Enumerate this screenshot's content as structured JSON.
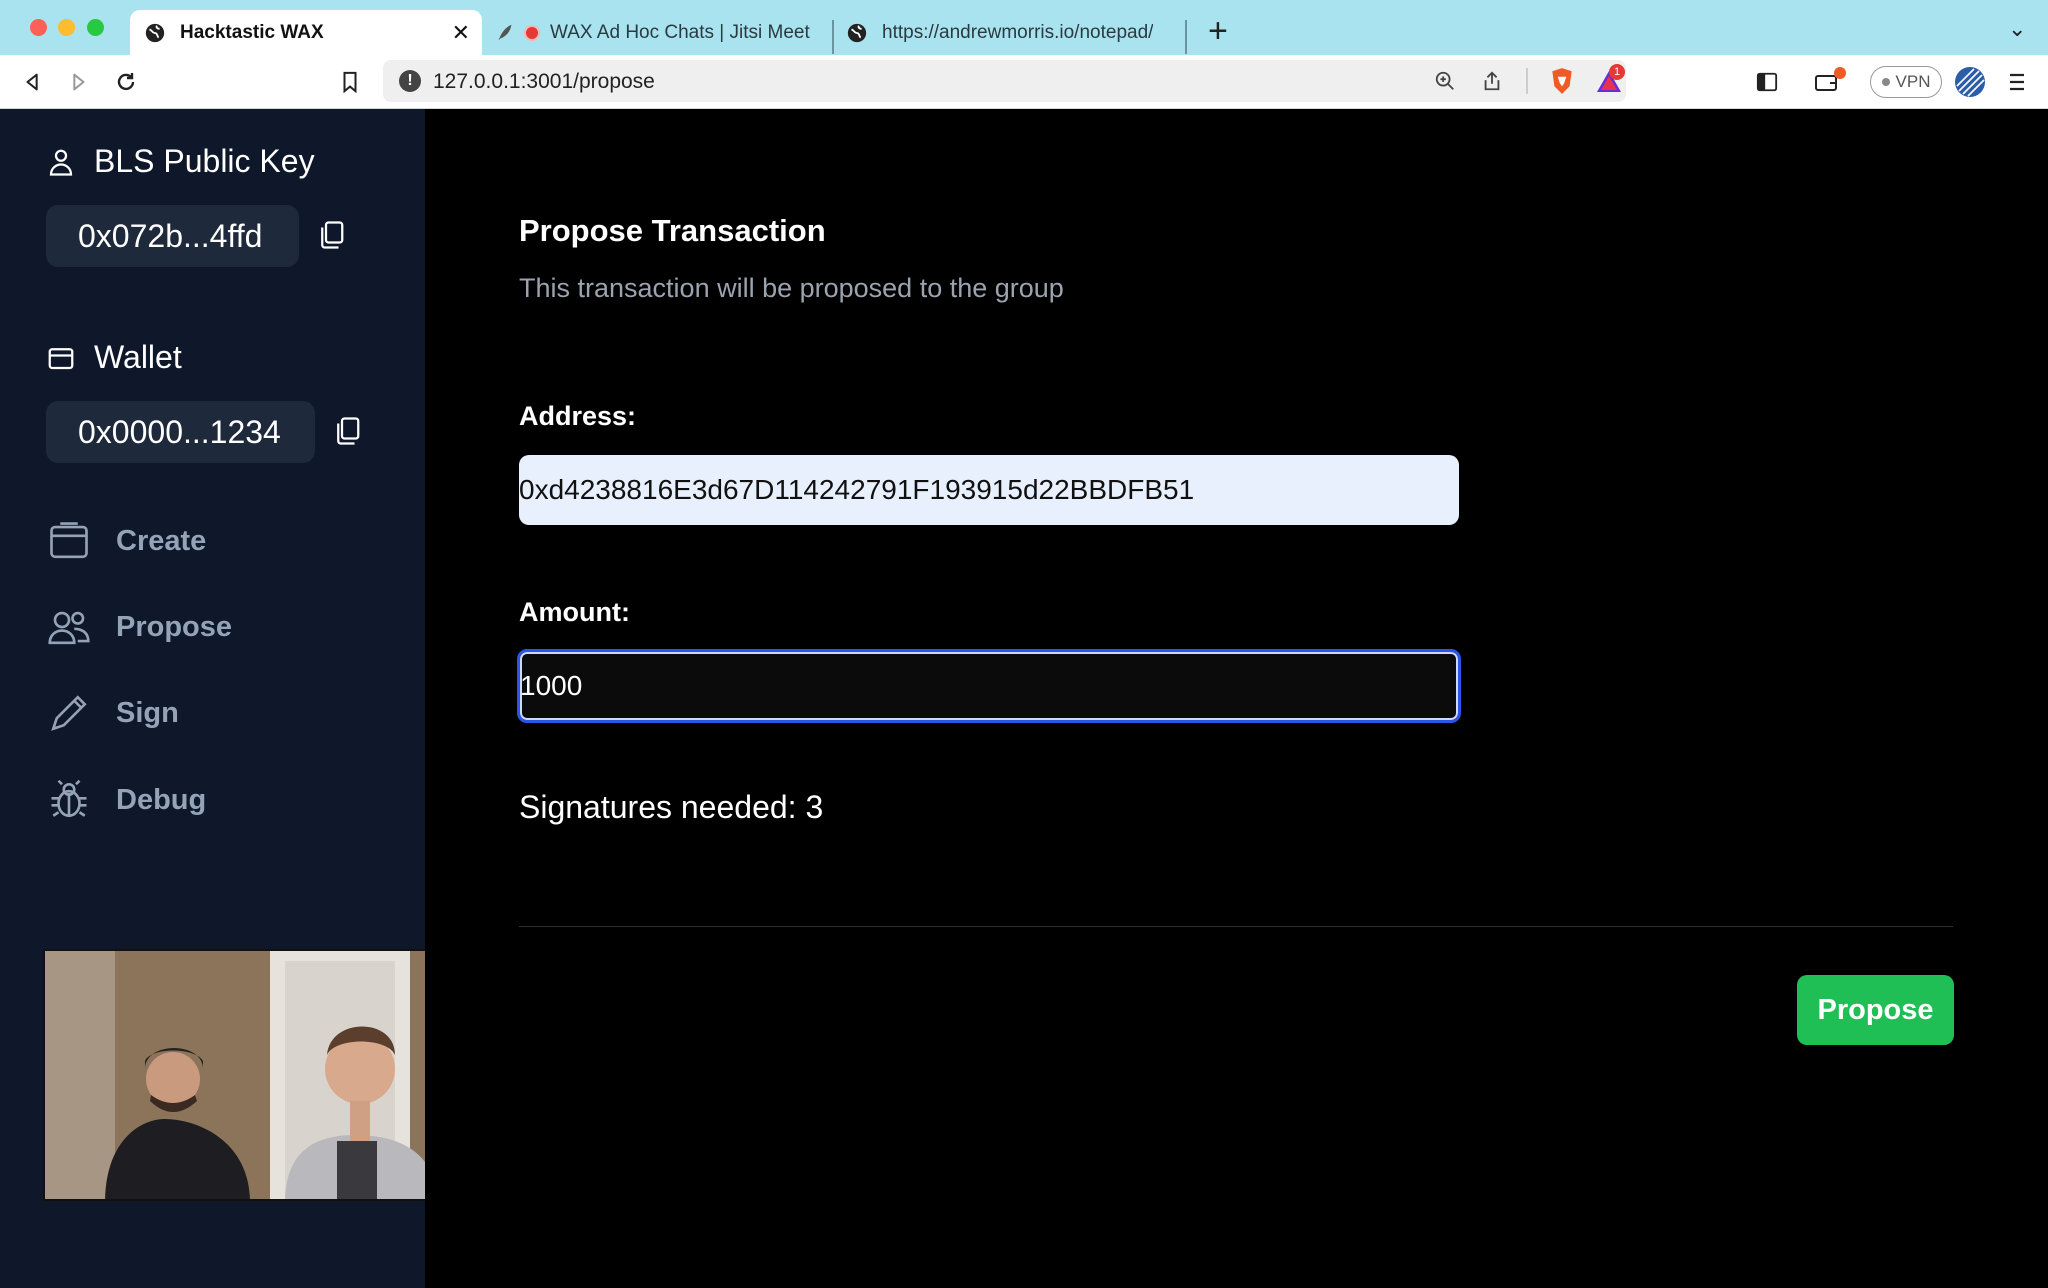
{
  "browser": {
    "tabs": [
      {
        "title": "Hacktastic WAX",
        "active": true
      },
      {
        "title": "WAX Ad Hoc Chats | Jitsi Meet",
        "active": false
      },
      {
        "title": "https://andrewmorris.io/notepad/",
        "active": false
      }
    ],
    "url": "127.0.0.1:3001/propose",
    "vpn_label": "VPN",
    "notification_count": "1"
  },
  "sidebar": {
    "bls_heading": "BLS Public Key",
    "bls_value": "0x072b...4ffd",
    "wallet_heading": "Wallet",
    "wallet_value": "0x0000...1234",
    "nav": [
      {
        "label": "Create",
        "icon": "wallet-card-icon"
      },
      {
        "label": "Propose",
        "icon": "users-icon"
      },
      {
        "label": "Sign",
        "icon": "pencil-icon"
      },
      {
        "label": "Debug",
        "icon": "bug-icon"
      }
    ]
  },
  "main": {
    "title": "Propose Transaction",
    "subtitle": "This transaction will be proposed to the group",
    "address_label": "Address:",
    "address_value": "0xd4238816E3d67D114242791F193915d22BBDFB51",
    "amount_label": "Amount:",
    "amount_value": "1000",
    "signatures_text": "Signatures needed: 3",
    "propose_button": "Propose"
  },
  "colors": {
    "sidebar_bg": "#0f172a",
    "main_bg": "#000000",
    "accent_green": "#1fbf55",
    "focus_blue": "#2a55e5",
    "tabbar_bg": "#a9e3ef"
  }
}
